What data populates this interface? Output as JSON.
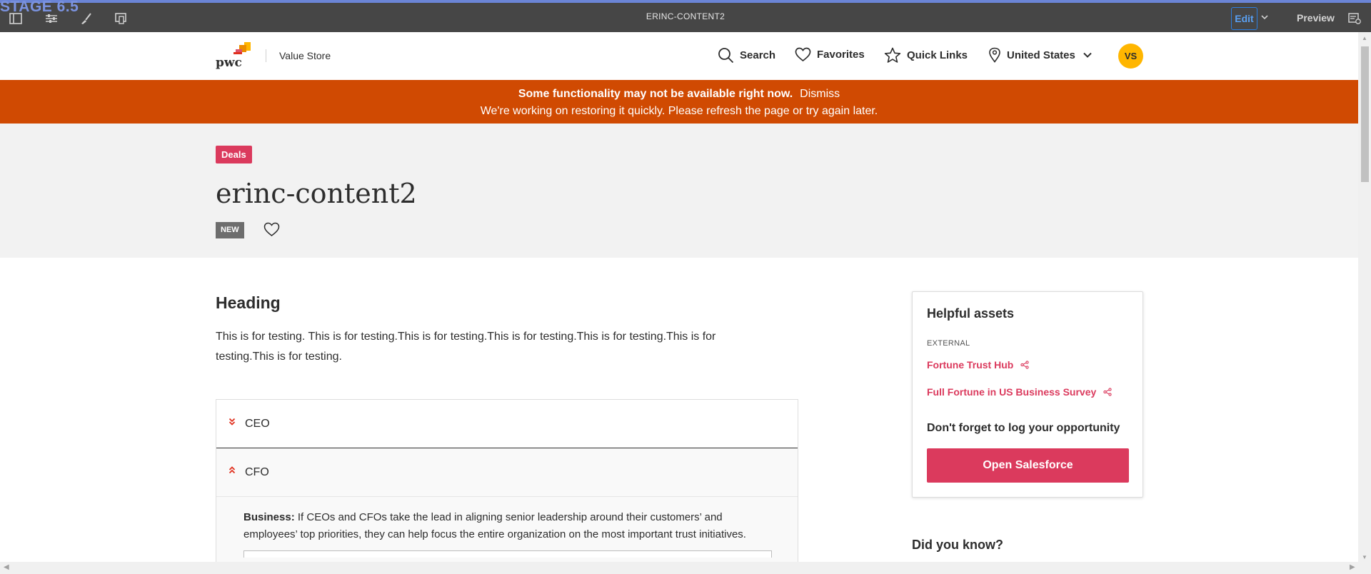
{
  "editor": {
    "stage_label": "STAGE 6.5",
    "page_title": "ERINC-CONTENT2",
    "edit_label": "Edit",
    "preview_label": "Preview",
    "icons": [
      "side-panel-icon",
      "properties-icon",
      "style-icon",
      "emulator-icon",
      "page-settings-icon"
    ]
  },
  "header": {
    "logo_text": "pwc",
    "store_name": "Value Store",
    "nav": {
      "search": "Search",
      "favorites": "Favorites",
      "quick_links": "Quick Links",
      "country": "United States"
    },
    "avatar_initials": "VS"
  },
  "banner": {
    "title": "Some functionality may not be available right now.",
    "dismiss": "Dismiss",
    "message": "We're working on restoring it quickly. Please refresh the page or try again later."
  },
  "hero": {
    "tag": "Deals",
    "title": "erinc-content2",
    "badge": "NEW"
  },
  "content": {
    "heading": "Heading",
    "body": "This is for testing. This is for testing.This is for testing.This is for testing.This is for testing.This is for testing.This is for testing.",
    "accordion": [
      {
        "label": "CEO",
        "expanded": false
      },
      {
        "label": "CFO",
        "expanded": true
      }
    ],
    "panel": {
      "label": "Business:",
      "text": "If CEOs and CFOs take the lead in aligning senior leadership around their customers’ and employees’ top priorities, they can help focus the entire organization on the most important trust initiatives."
    }
  },
  "sidebar": {
    "title": "Helpful assets",
    "category": "EXTERNAL",
    "links": [
      "Fortune Trust Hub",
      "Full Fortune in US Business Survey"
    ],
    "reminder": "Don't forget to log your opportunity",
    "button": "Open Salesforce",
    "did_you_know": "Did you know?"
  },
  "colors": {
    "brand_orange": "#d04a02",
    "accent_pink": "#db3a5d",
    "avatar_yellow": "#ffb600",
    "editor_bar": "#464646"
  }
}
